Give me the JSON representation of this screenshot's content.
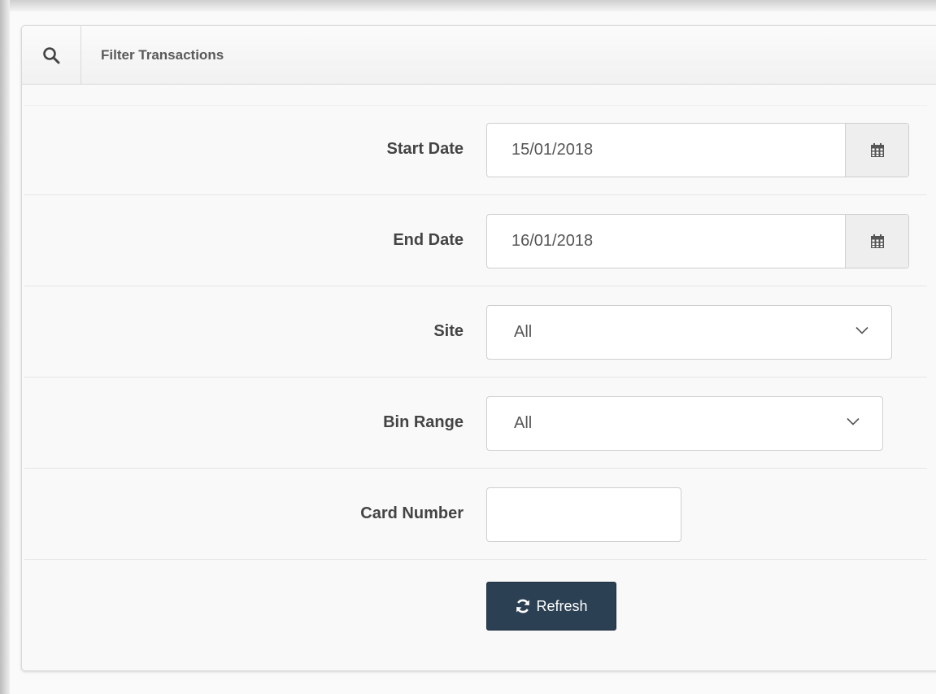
{
  "panel": {
    "title": "Filter Transactions",
    "header_icon": "search-icon"
  },
  "form": {
    "start_date": {
      "label": "Start Date",
      "value": "15/01/2018",
      "icon": "calendar-icon"
    },
    "end_date": {
      "label": "End Date",
      "value": "16/01/2018",
      "icon": "calendar-icon"
    },
    "site": {
      "label": "Site",
      "selected": "All",
      "icon": "chevron-down-icon"
    },
    "bin_range": {
      "label": "Bin Range",
      "selected": "All",
      "icon": "chevron-down-icon"
    },
    "card_number": {
      "label": "Card Number",
      "value": ""
    },
    "refresh_button": {
      "label": "Refresh",
      "icon": "refresh-icon"
    }
  },
  "colors": {
    "button_bg": "#2c4054",
    "panel_bg": "#f9f9f9",
    "label_text": "#444444"
  }
}
